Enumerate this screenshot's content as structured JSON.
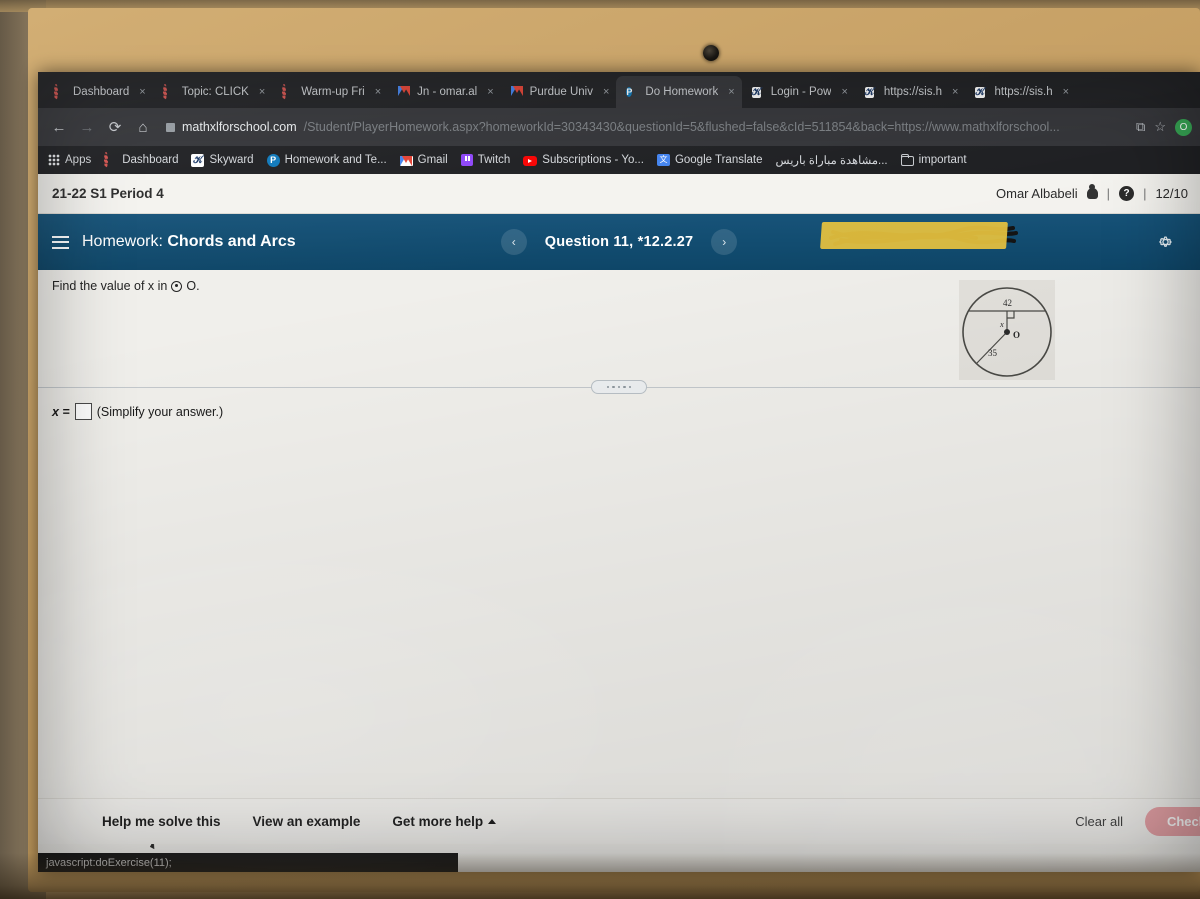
{
  "browser": {
    "tabs": [
      {
        "title": "Dashboard",
        "favicon": "ring-icon",
        "active": false
      },
      {
        "title": "Topic: CLICK",
        "favicon": "ring-icon",
        "active": false
      },
      {
        "title": "Warm-up Fri",
        "favicon": "ring-icon",
        "active": false
      },
      {
        "title": "Jn - omar.al",
        "favicon": "gmail-icon",
        "active": false
      },
      {
        "title": "Purdue Univ",
        "favicon": "gmail-icon",
        "active": false
      },
      {
        "title": "Do Homework",
        "favicon": "pearson-icon",
        "active": true
      },
      {
        "title": "Login - Pow",
        "favicon": "powerschool-icon",
        "active": false
      },
      {
        "title": "https://sis.h",
        "favicon": "powerschool-icon",
        "active": false
      },
      {
        "title": "https://sis.h",
        "favicon": "powerschool-icon",
        "active": false
      }
    ],
    "tab_close_label": "×",
    "nav": {
      "back": "←",
      "forward": "→",
      "reload": "⟳",
      "home": "⌂"
    },
    "url_host": "mathxlforschool.com",
    "url_path": "/Student/PlayerHomework.aspx?homeworkId=30343430&questionId=5&flushed=false&cId=511854&back=https://www.mathxlforschool...",
    "toolbar_icons": {
      "install": "⧉",
      "bookmark_star": "☆",
      "profile": "O"
    },
    "bookmarks": [
      {
        "label": "Apps",
        "icon": "apps-grid-icon"
      },
      {
        "label": "Dashboard",
        "icon": "ring-icon"
      },
      {
        "label": "Skyward",
        "icon": "skyward-icon"
      },
      {
        "label": "Homework and Te...",
        "icon": "pearson-icon"
      },
      {
        "label": "Gmail",
        "icon": "gmail-icon"
      },
      {
        "label": "Twitch",
        "icon": "twitch-icon"
      },
      {
        "label": "Subscriptions - Yo...",
        "icon": "youtube-icon"
      },
      {
        "label": "Google Translate",
        "icon": "google-translate-icon"
      },
      {
        "label": "مشاهدة مباراة باريس...",
        "icon": "none"
      },
      {
        "label": "important",
        "icon": "folder-icon"
      }
    ]
  },
  "course_bar": {
    "title": "21-22 S1 Period 4",
    "user_name": "Omar Albabeli",
    "separator": "|",
    "help_label": "?",
    "date": "12/10"
  },
  "homework_header": {
    "menu_icon": "hamburger-icon",
    "label": "Homework:",
    "name": "Chords and Arcs",
    "prev_arrow": "‹",
    "next_arrow": "›",
    "question_label": "Question 11, *12.2.27",
    "settings_icon": "gear-icon",
    "bar_color": "#0e4d73",
    "highlight_color": "#e8c33a"
  },
  "question": {
    "prompt_before": "Find the value of x in",
    "circle_symbol": "⊙",
    "prompt_after": "O.",
    "answer_label": "x =",
    "answer_value": "",
    "answer_hint": "(Simplify your answer.)"
  },
  "figure": {
    "type": "circle-with-chord",
    "center_label": "O",
    "chord_label": "42",
    "distance_label": "x",
    "radius_label": "35",
    "right_angle": true
  },
  "bottom_bar": {
    "help_me_solve": "Help me solve this",
    "view_example": "View an example",
    "get_more_help": "Get more help",
    "get_more_help_caret": "▲",
    "clear_all": "Clear all",
    "check_answer": "Check",
    "check_color": "#e8a0a5"
  },
  "status_bar": {
    "text": "javascript:doExercise(11);"
  }
}
